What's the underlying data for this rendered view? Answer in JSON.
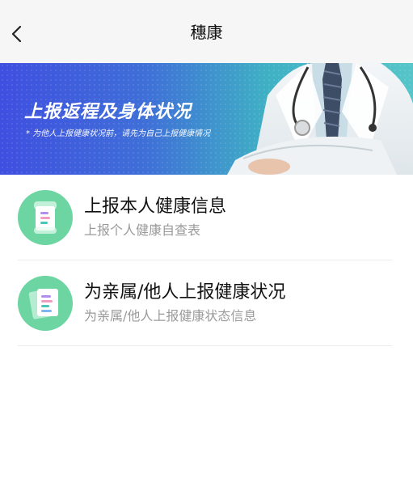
{
  "header": {
    "title": "穗康",
    "back_icon": "chevron-left-icon"
  },
  "banner": {
    "title": "上报返程及身体状况",
    "subtitle": "* 为他人上报健康状况前，请先为自己上报健康情况",
    "gradient_start": "#3f4fe0",
    "gradient_end": "#55c5c9"
  },
  "items": [
    {
      "title": "上报本人健康信息",
      "subtitle": "上报个人健康自查表",
      "icon": "health-form-icon"
    },
    {
      "title": "为亲属/他人上报健康状况",
      "subtitle": "为亲属/他人上报健康状态信息",
      "icon": "stacked-forms-icon"
    }
  ],
  "colors": {
    "icon_bg": "#6cd5a2",
    "title_text": "#111111",
    "subtitle_text": "#9a9a9a"
  }
}
